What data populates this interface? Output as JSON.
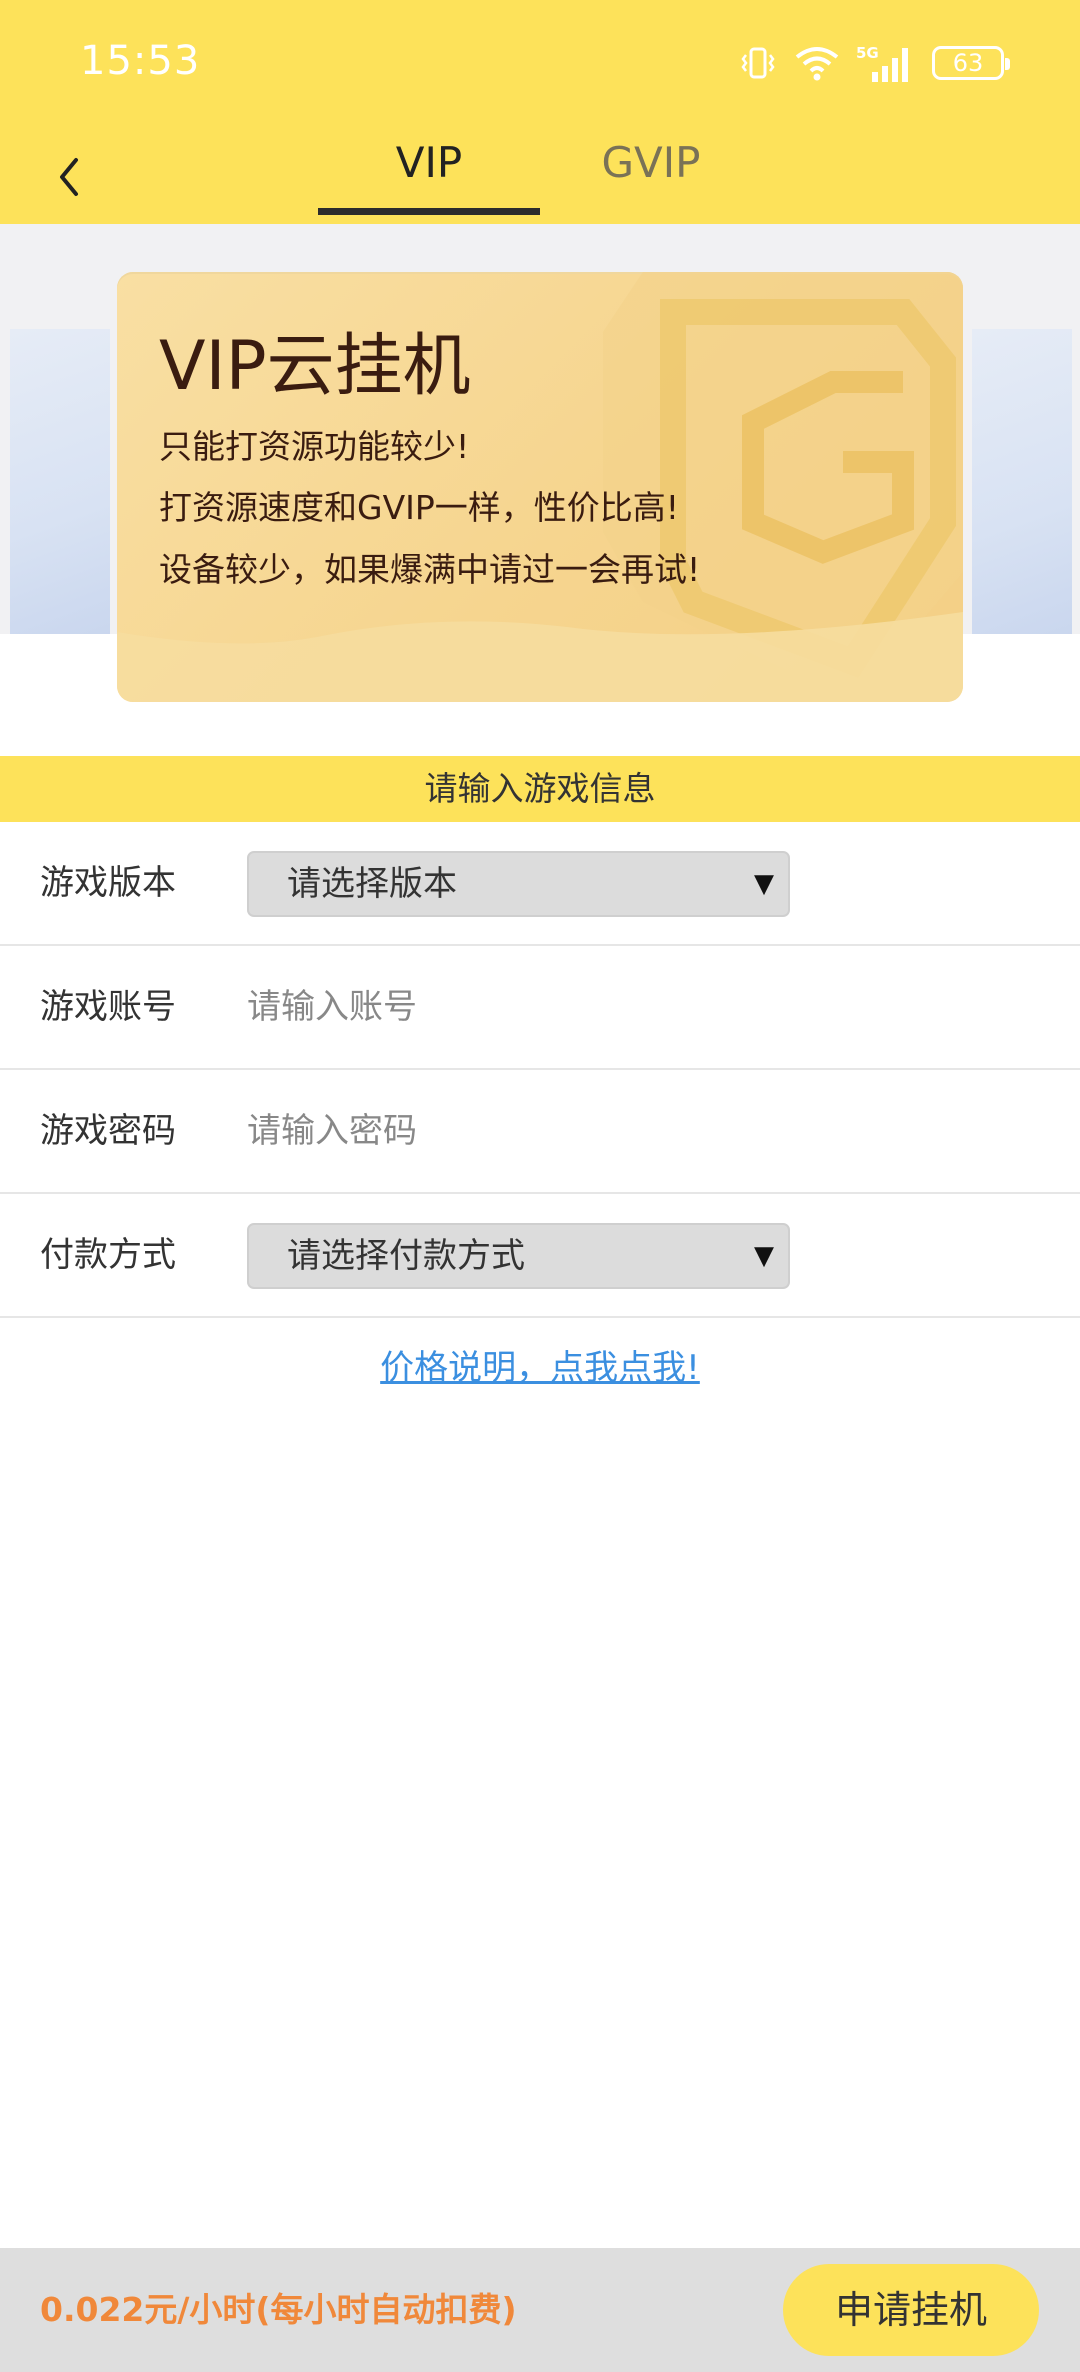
{
  "status_bar": {
    "time": "15:53",
    "network": "5G",
    "battery": "63",
    "icons": [
      "vibrate-icon",
      "wifi-icon",
      "signal-5g-icon",
      "battery-icon"
    ]
  },
  "header": {
    "back_icon": "chevron-left-icon",
    "tabs": [
      {
        "label": "VIP",
        "active": true
      },
      {
        "label": "GVIP",
        "active": false
      }
    ]
  },
  "banner": {
    "title": "VIP云挂机",
    "lines": [
      "只能打资源功能较少!",
      "打资源速度和GVIP一样，性价比高!",
      "设备较少，如果爆满中请过一会再试!"
    ]
  },
  "section": {
    "title": "请输入游戏信息"
  },
  "form": {
    "version": {
      "label": "游戏版本",
      "value": "请选择版本"
    },
    "account": {
      "label": "游戏账号",
      "placeholder": "请输入账号"
    },
    "password": {
      "label": "游戏密码",
      "placeholder": "请输入密码"
    },
    "payment": {
      "label": "付款方式",
      "value": "请选择付款方式"
    },
    "dropdown_arrow": "▼"
  },
  "price_link": "价格说明，点我点我!",
  "bottom": {
    "price": "0.022元/小时(每小时自动扣费)",
    "apply_label": "申请挂机"
  },
  "colors": {
    "brand_yellow": "#fde25a",
    "link_blue": "#3b8fe0",
    "price_orange": "#f0883a",
    "banner_text": "#3a1c10"
  }
}
